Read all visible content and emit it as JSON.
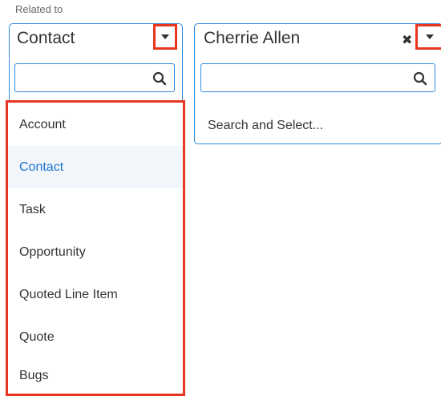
{
  "field_label": "Related to",
  "left_select": {
    "value": "Contact",
    "search_placeholder": "",
    "options": [
      "Account",
      "Contact",
      "Task",
      "Opportunity",
      "Quoted Line Item",
      "Quote",
      "Bugs"
    ],
    "active_option": "Contact"
  },
  "right_select": {
    "value": "Cherrie Allen",
    "search_placeholder": "",
    "hint": "Search and Select..."
  },
  "colors": {
    "focus_border": "#2d8ae0",
    "highlight_box": "#e8351f",
    "active_option_text": "#1a74d2",
    "active_option_bg": "#f2f6fb"
  },
  "icons": {
    "dropdown": "chevron-down-icon",
    "search": "search-icon",
    "clear": "close-icon"
  }
}
